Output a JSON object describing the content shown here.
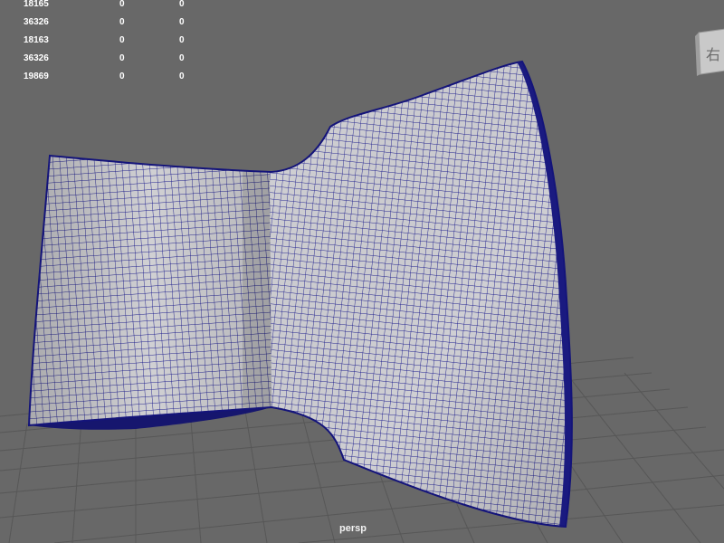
{
  "hud": {
    "rows": [
      {
        "a": "18165",
        "b": "0",
        "c": "0"
      },
      {
        "a": "36326",
        "b": "0",
        "c": "0"
      },
      {
        "a": "18163",
        "b": "0",
        "c": "0"
      },
      {
        "a": "36326",
        "b": "0",
        "c": "0"
      },
      {
        "a": "19869",
        "b": "0",
        "c": "0"
      }
    ]
  },
  "viewport": {
    "camera_label": "persp",
    "view_cube_label": "右",
    "background_color": "#686868",
    "grid_color": "#565656",
    "mesh_fill_color": "#d2d2d4",
    "wireframe_color": "#1a1a8c"
  }
}
